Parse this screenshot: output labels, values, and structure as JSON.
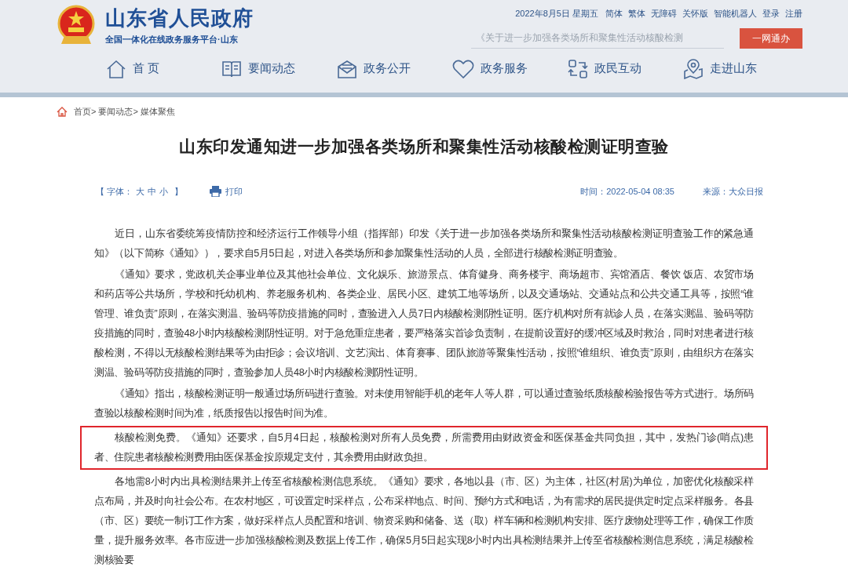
{
  "header": {
    "site_title": "山东省人民政府",
    "site_subtitle": "全国一体化在线政务服务平台·山东",
    "date": "2022年8月5日 星期五",
    "top_links": [
      "简体",
      "繁体",
      "无障碍",
      "关怀版",
      "智能机器人",
      "登录",
      "注册"
    ],
    "search": {
      "value": "《关于进一步加强各类场所和聚集性活动核酸检测"
    },
    "search_button": "一网通办"
  },
  "nav": [
    {
      "label": "首 页"
    },
    {
      "label": "要闻动态"
    },
    {
      "label": "政务公开"
    },
    {
      "label": "政务服务"
    },
    {
      "label": "政民互动"
    },
    {
      "label": "走进山东"
    }
  ],
  "breadcrumb": [
    "首页>",
    "要闻动态>",
    "媒体聚焦"
  ],
  "article": {
    "title": "山东印发通知进一步加强各类场所和聚集性活动核酸检测证明查验",
    "font_label": "【 字体：",
    "font_sizes": [
      "大",
      "中",
      "小"
    ],
    "font_close": "】",
    "print": "打印",
    "time": "时间：2022-05-04 08:35",
    "source": "来源：大众日报",
    "paragraphs": [
      {
        "text": "近日，山东省委统筹疫情防控和经济运行工作领导小组（指挥部）印发《关于进一步加强各类场所和聚集性活动核酸检测证明查验工作的紧急通知》（以下简称《通知》），要求自5月5日起，对进入各类场所和参加聚集性活动的人员，全部进行核酸检测证明查验。",
        "highlighted": false
      },
      {
        "text": "《通知》要求，党政机关企事业单位及其他社会单位、文化娱乐、旅游景点、体育健身、商务楼宇、商场超市、宾馆酒店、餐饮 饭店、农贸市场和药店等公共场所，学校和托幼机构、养老服务机构、各类企业、居民小区、建筑工地等场所，以及交通场站、交通站点和公共交通工具等，按照“谁管理、谁负责”原则，在落实测温、验码等防疫措施的同时，查验进入人员7日内核酸检测阴性证明。医疗机构对所有就诊人员，在落实测温、验码等防疫措施的同时，查验48小时内核酸检测阴性证明。对于急危重症患者，要严格落实首诊负责制，在提前设置好的缓冲区域及时救治，同时对患者进行核酸检测，不得以无核酸检测结果等为由拒诊；会议培训、文艺演出、体育赛事、团队旅游等聚集性活动，按照“谁组织、谁负责”原则，由组织方在落实测温、验码等防疫措施的同时，查验参加人员48小时内核酸检测阴性证明。",
        "highlighted": false
      },
      {
        "text": "《通知》指出，核酸检测证明一般通过场所码进行查验。对未使用智能手机的老年人等人群，可以通过查验纸质核酸检验报告等方式进行。场所码查验以核酸检测时间为准，纸质报告以报告时间为准。",
        "highlighted": false
      },
      {
        "text": "核酸检测免费。《通知》还要求，自5月4日起，核酸检测对所有人员免费，所需费用由财政资金和医保基金共同负担，其中，发热门诊(哨点)患者、住院患者核酸检测费用由医保基金按原规定支付，其余费用由财政负担。",
        "highlighted": true
      },
      {
        "text": "各地需8小时内出具检测结果并上传至省核酸检测信息系统。《通知》要求，各地以县（市、区）为主体，社区(村居)为单位，加密优化核酸采样点布局，并及时向社会公布。在农村地区，可设置定时采样点，公布采样地点、时间、预约方式和电话，为有需求的居民提供定时定点采样服务。各县（市、区）要统一制订工作方案，做好采样点人员配置和培训、物资采购和储备、送（取）样车辆和检测机构安排、医疗废物处理等工作，确保工作质量，提升服务效率。各市应进一步加强核酸检测及数据上传工作，确保5月5日起实现8小时内出具检测结果并上传至省核酸检测信息系统，满足核酸检测核验要",
        "highlighted": false
      }
    ]
  }
}
